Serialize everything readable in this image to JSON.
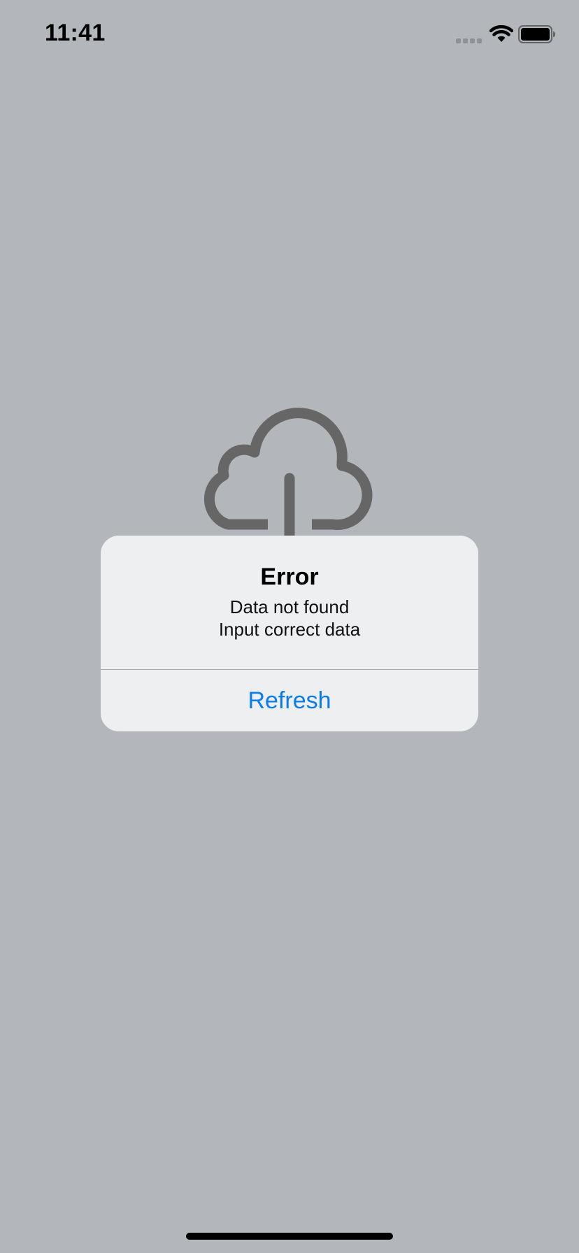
{
  "status_bar": {
    "time": "11:41",
    "icons": [
      "cellular-signal-icon",
      "wifi-icon",
      "battery-icon"
    ]
  },
  "illustration": {
    "icon": "cloud-icon"
  },
  "alert": {
    "title": "Error",
    "message_line1": "Data not found",
    "message_line2": "Input correct data",
    "button_label": "Refresh"
  },
  "colors": {
    "background": "#b3b7bb",
    "alert_background": "#eeeff1",
    "accent": "#0a7cf0",
    "cloud_stroke": "#666666"
  }
}
